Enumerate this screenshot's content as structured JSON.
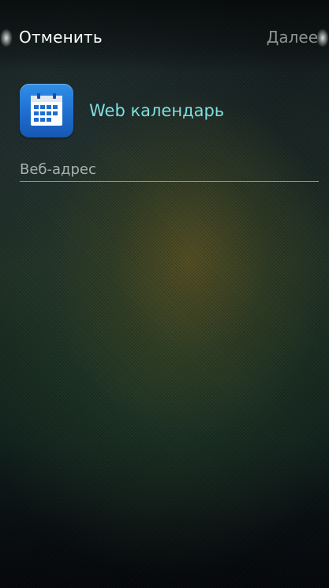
{
  "header": {
    "cancel_label": "Отменить",
    "next_label": "Далее"
  },
  "app": {
    "name": "Web календарь",
    "icon": "calendar-icon"
  },
  "url_field": {
    "placeholder": "Веб-адрес",
    "value": ""
  },
  "colors": {
    "title_accent": "#7fe0de",
    "next_disabled": "#8a9390",
    "icon_blue": "#1f6dcf"
  }
}
